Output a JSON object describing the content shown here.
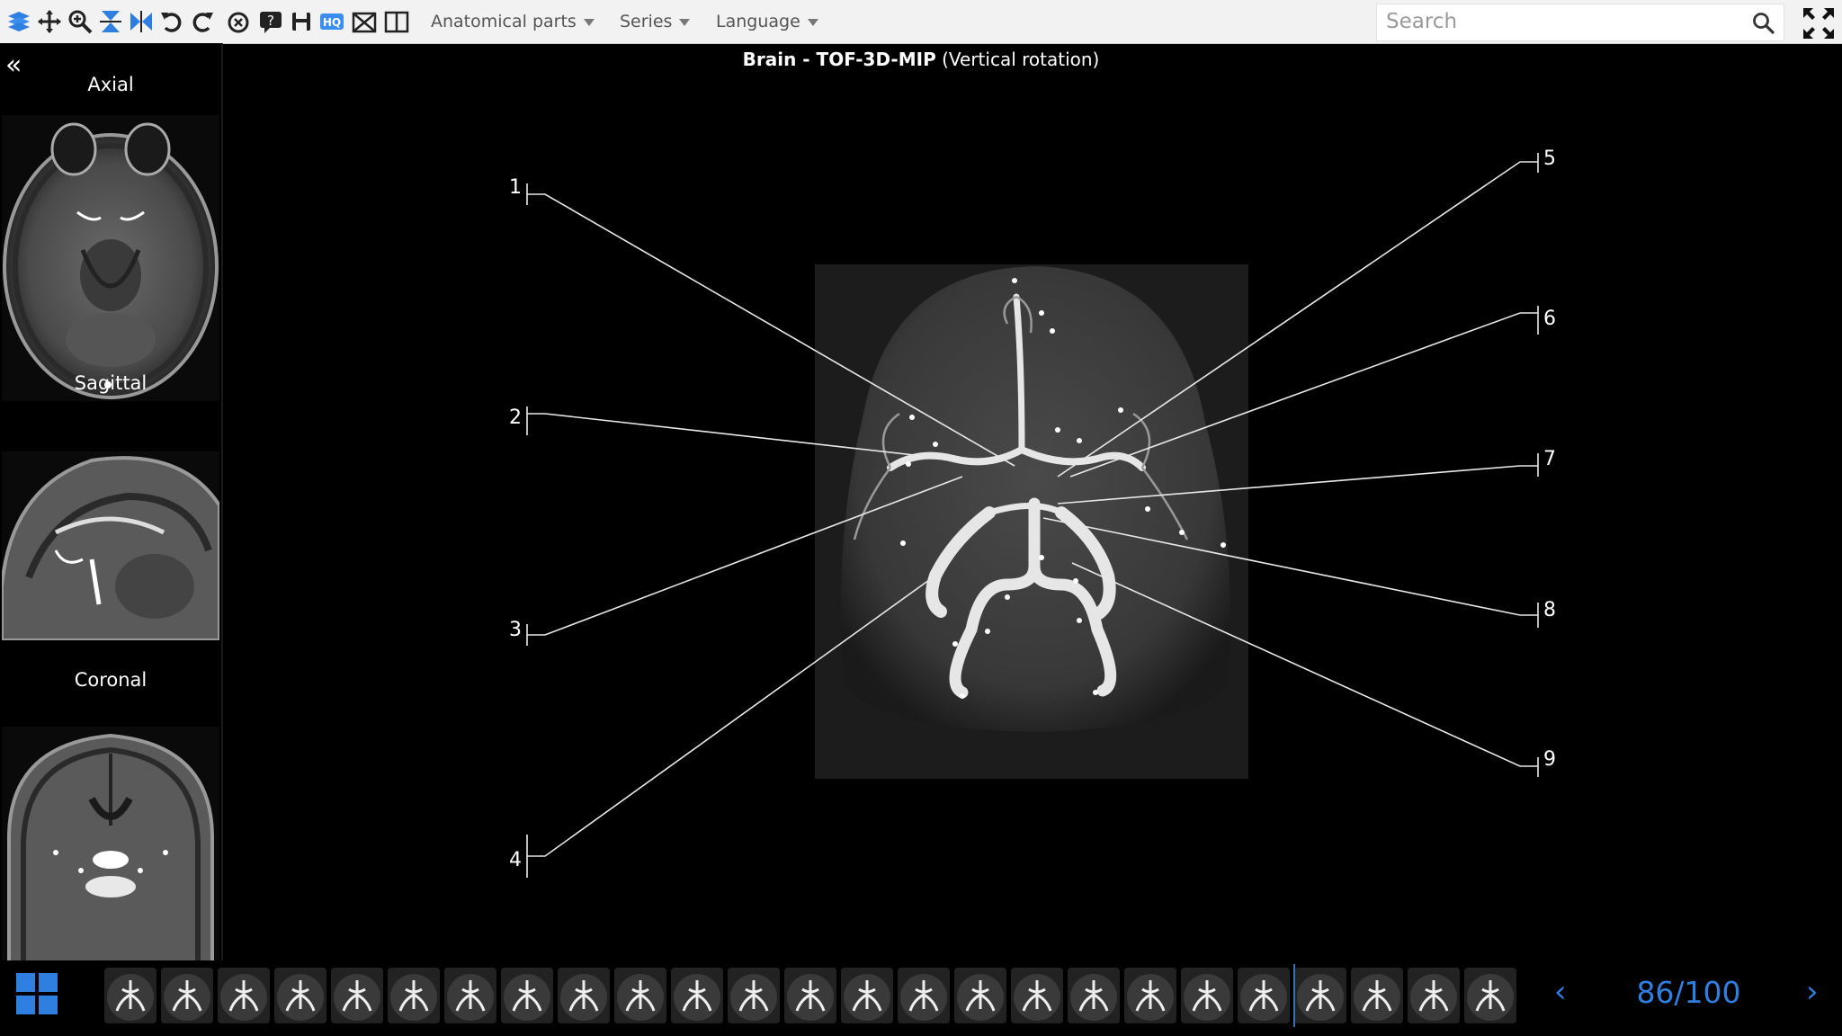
{
  "toolbar": {
    "menus": [
      {
        "label": "Anatomical parts"
      },
      {
        "label": "Series"
      },
      {
        "label": "Language"
      }
    ],
    "search_placeholder": "Search",
    "accent_color": "#2f7fe0"
  },
  "sidebar": {
    "views": [
      {
        "label": "Axial"
      },
      {
        "label": "Sagittal"
      },
      {
        "label": "Coronal"
      }
    ]
  },
  "main": {
    "title_bold": "Brain - TOF-3D-MIP",
    "title_rest": "(Vertical rotation)",
    "labels": [
      "1",
      "2",
      "3",
      "4",
      "5",
      "6",
      "7",
      "8",
      "9"
    ]
  },
  "navigation": {
    "counter": "86/100",
    "current": 86,
    "total": 100,
    "filmstrip_count": 25
  }
}
